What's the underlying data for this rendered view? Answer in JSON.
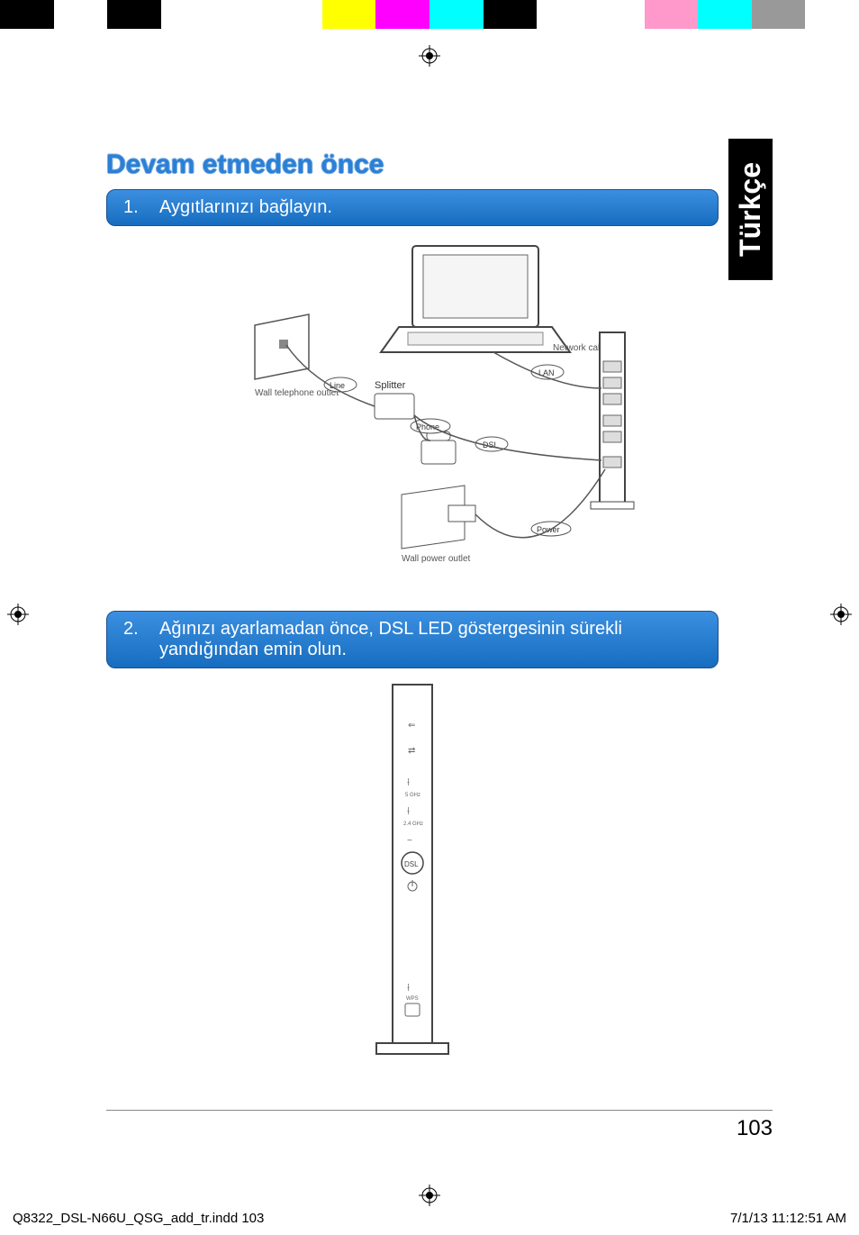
{
  "language_tab": "Türkçe",
  "title": "Devam etmeden önce",
  "steps": [
    {
      "num": "1.",
      "text": "Aygıtlarınızı bağlayın."
    },
    {
      "num": "2.",
      "text": "Ağınızı ayarlamadan önce, DSL LED göstergesinin sürekli yandığından emin olun."
    }
  ],
  "diagram1": {
    "labels": {
      "wall_telephone_outlet": "Wall telephone outlet",
      "line": "Line",
      "splitter": "Splitter",
      "phone": "Phone",
      "dsl": "DSL",
      "lan": "LAN",
      "network_cable": "Network cable",
      "wall_power_outlet": "Wall power outlet",
      "power": "Power"
    }
  },
  "diagram2": {
    "labels": {
      "ghz5": "5 GHz",
      "ghz24": "2.4 GHz",
      "dsl": "DSL",
      "wps": "WPS"
    }
  },
  "page_number": "103",
  "footer_file": "Q8322_DSL-N66U_QSG_add_tr.indd   103",
  "footer_time": "7/1/13   11:12:51 AM"
}
